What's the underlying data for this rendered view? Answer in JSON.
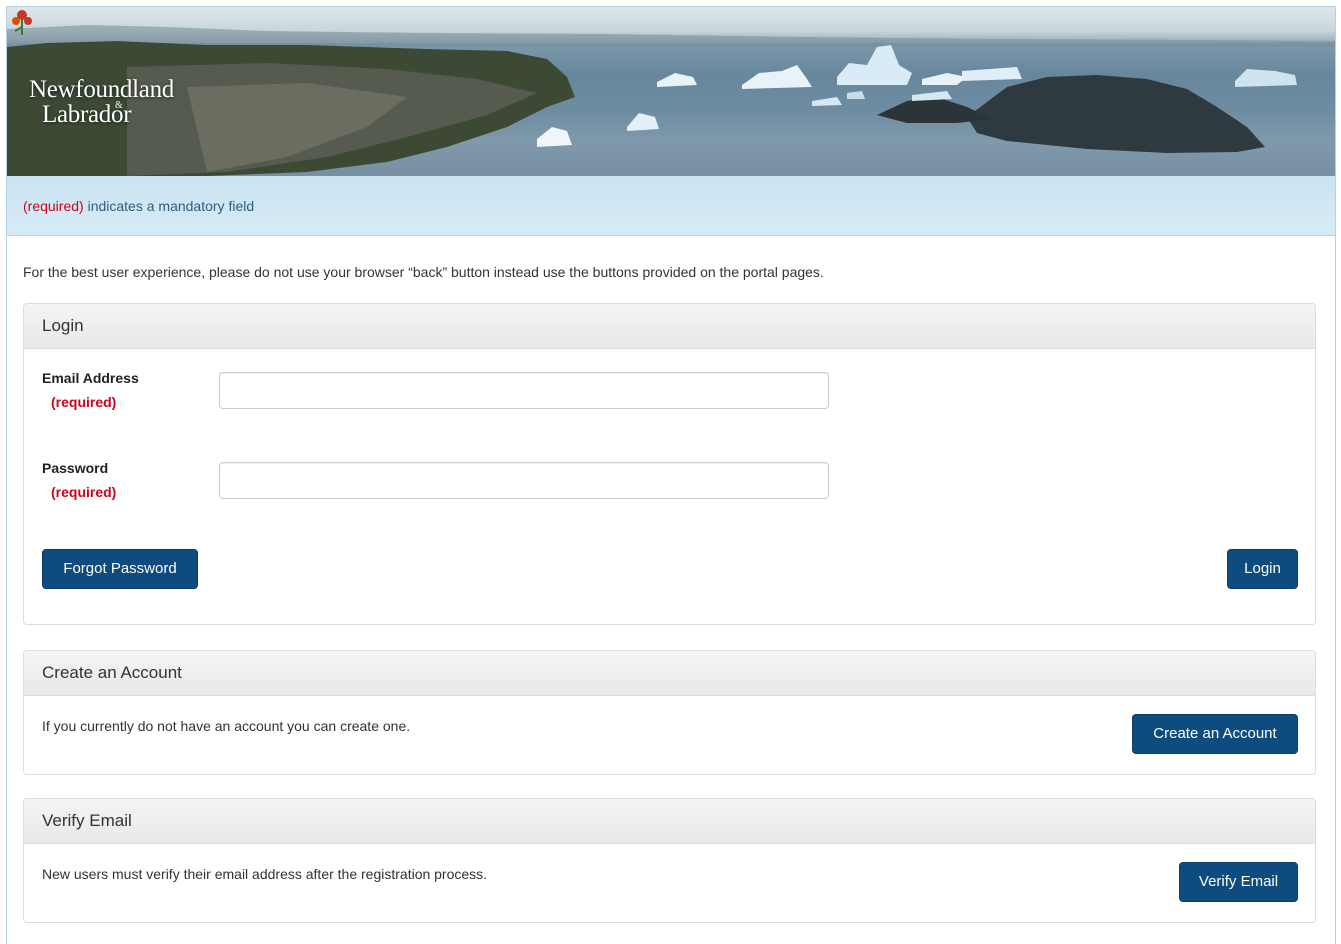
{
  "brand": {
    "logo_line1": "Newfoundland",
    "logo_amp": "&",
    "logo_line2": "Labrador"
  },
  "notice": {
    "required_marker": "(required)",
    "text": " indicates a mandatory field"
  },
  "intro_text": "For the best user experience, please do not use your browser “back” button instead use the buttons provided on the portal pages.",
  "login": {
    "heading": "Login",
    "email_label": "Email Address",
    "email_required": "(required)",
    "email_value": "",
    "password_label": "Password",
    "password_required": "(required)",
    "password_value": "",
    "forgot_button": "Forgot Password",
    "login_button": "Login"
  },
  "create_account": {
    "heading": "Create an Account",
    "text": "If you currently do not have an account you can create one.",
    "button": "Create an Account"
  },
  "verify_email": {
    "heading": "Verify Email",
    "text": "New users must verify their email address after the registration process.",
    "button": "Verify Email"
  },
  "colors": {
    "primary_button": "#0e4c7f",
    "required_red": "#d0021b",
    "notice_bg": "#cde6f4"
  }
}
